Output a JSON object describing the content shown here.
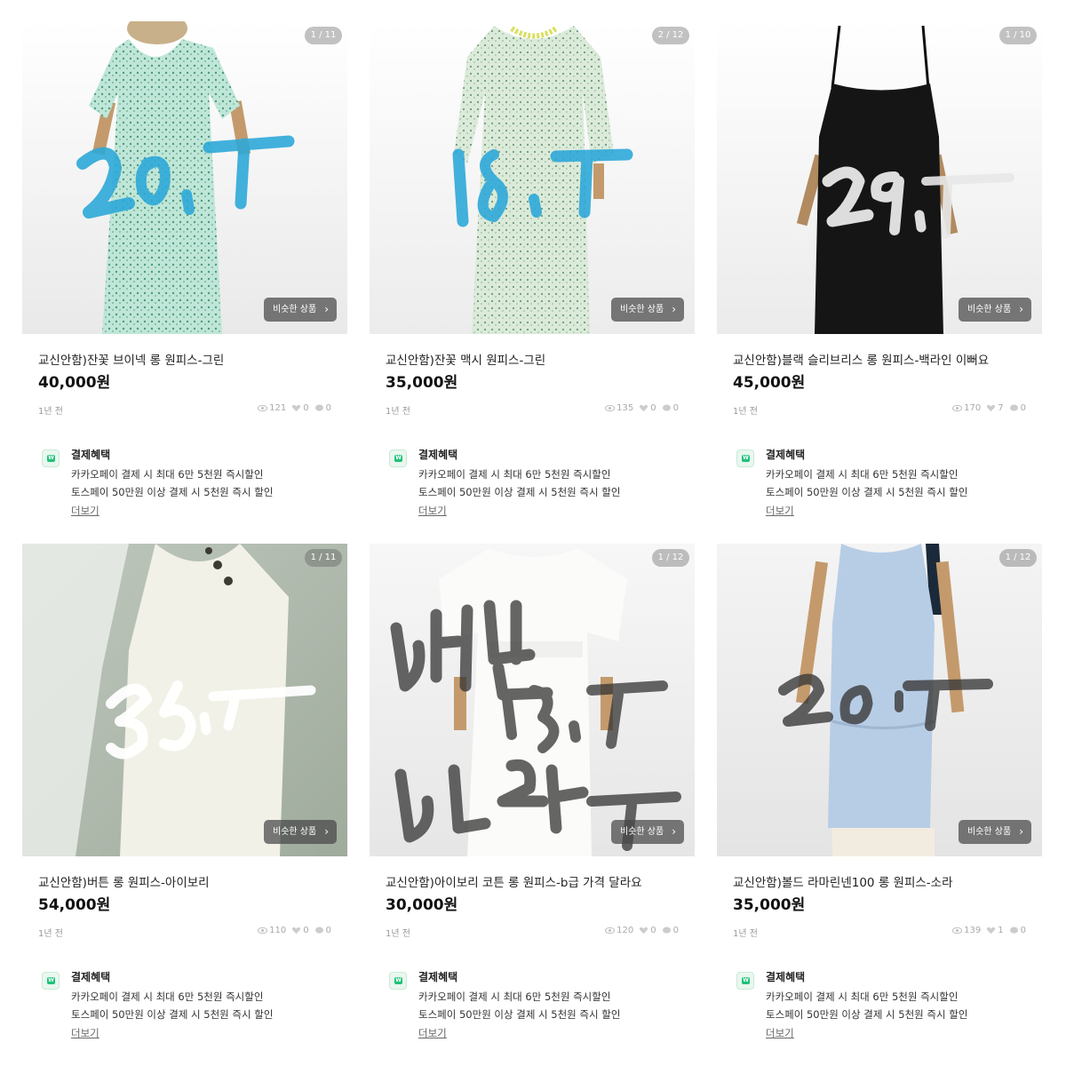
{
  "common": {
    "similar_label": "비슷한 상품",
    "time_ago": "1년 전",
    "benefit_title": "결제혜택",
    "benefit_line1": "카카오페이 결제 시 최대 6만 5천원 즉시할인",
    "benefit_line2": "토스페이 50만원 이상 결제 시 5천원 즉시 할인",
    "more_label": "더보기",
    "accent_color": "#1ec27a"
  },
  "products": [
    {
      "pager": "1 / 11",
      "title": "교신안함)잔꽃 브이넥 롱 원피스-그린",
      "price": "40,000원",
      "views": "121",
      "likes": "0",
      "chats": "0"
    },
    {
      "pager": "2 / 12",
      "title": "교신안함)잔꽃 맥시 원피스-그린",
      "price": "35,000원",
      "views": "135",
      "likes": "0",
      "chats": "0"
    },
    {
      "pager": "1 / 10",
      "title": "교신안함)블랙 슬리브리스 롱 원피스-백라인 이뻐요",
      "price": "45,000원",
      "views": "170",
      "likes": "7",
      "chats": "0"
    },
    {
      "pager": "1 / 11",
      "title": "교신안함)버튼 롱 원피스-아이보리",
      "price": "54,000원",
      "views": "110",
      "likes": "0",
      "chats": "0"
    },
    {
      "pager": "1 / 12",
      "title": "교신안함)아이보리 코튼 롱 원피스-b급 가격 달라요",
      "price": "30,000원",
      "views": "120",
      "likes": "0",
      "chats": "0"
    },
    {
      "pager": "1 / 12",
      "title": "교신안함)볼드 라마린넨100 롱 원피스-소라",
      "price": "35,000원",
      "views": "139",
      "likes": "1",
      "chats": "0"
    }
  ]
}
